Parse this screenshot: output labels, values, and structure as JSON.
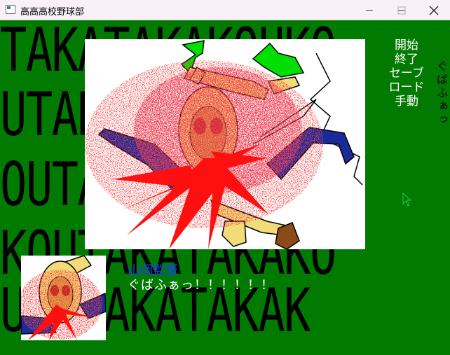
{
  "window": {
    "title": "高高高校野球部",
    "icon": "app-window-icon",
    "buttons": [
      "minimize-icon",
      "maximize-icon",
      "close-icon"
    ]
  },
  "background": {
    "rows": [
      "TAKATAKAKOUKO",
      "UTAKATAKATOUK",
      "OUTAKATAKAKOU",
      "KOUTAKATAKAKO",
      "UOUTAKATAKAK"
    ],
    "color": "#007a00"
  },
  "menu": {
    "items": [
      "開始",
      "終了",
      "セーブ",
      "ロード",
      "手動"
    ]
  },
  "scene": {
    "speech_text": "ぐばふぁっ"
  },
  "dialog": {
    "speaker": "山岡監督",
    "text": "ぐばふぁっ！！！！！！"
  },
  "colors": {
    "blood": "#e81010",
    "speaker": "#1a3cff",
    "leaf": "#00e000",
    "body": "#f2dc78",
    "arm": "#1a2a9a"
  }
}
